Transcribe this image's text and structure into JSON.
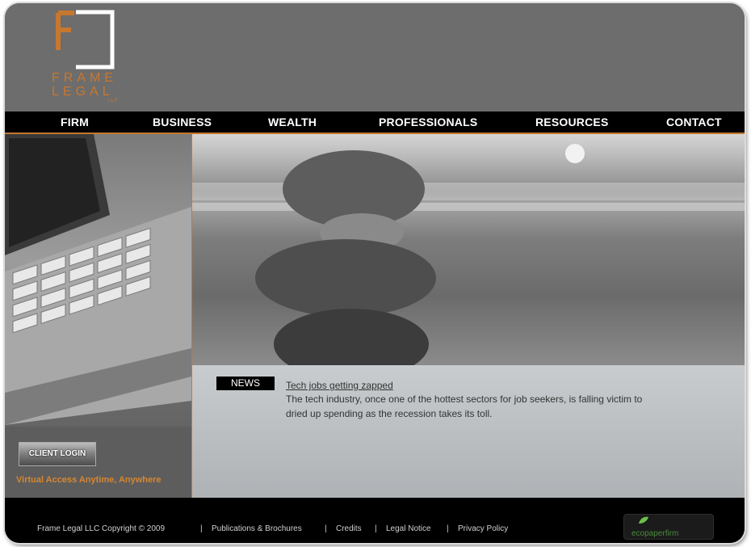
{
  "logo": {
    "letter": "F",
    "line1": "FRAME",
    "line2": "LEGAL",
    "suffix": "LLP"
  },
  "nav": {
    "items": [
      "FIRM",
      "BUSINESS",
      "WEALTH",
      "PROFESSIONALS",
      "RESOURCES",
      "CONTACT"
    ]
  },
  "sidebar": {
    "login_label": "CLIENT LOGIN",
    "tagline": "Virtual Access Anytime, Anywhere"
  },
  "news": {
    "label": "NEWS",
    "title": "Tech jobs getting zapped",
    "body": "The tech industry, once one of the hottest sectors for job seekers, is falling victim to dried up spending as the recession takes its toll."
  },
  "footer": {
    "copyright": "Frame Legal LLC  Copyright © 2009",
    "links": [
      "Publications & Brochures",
      "Credits",
      "Legal Notice",
      "Privacy Policy"
    ],
    "badge": "ecopaperfirm"
  },
  "colors": {
    "accent": "#c8772f",
    "nav_bg": "#000000",
    "header_bg": "#6d6d6d"
  }
}
